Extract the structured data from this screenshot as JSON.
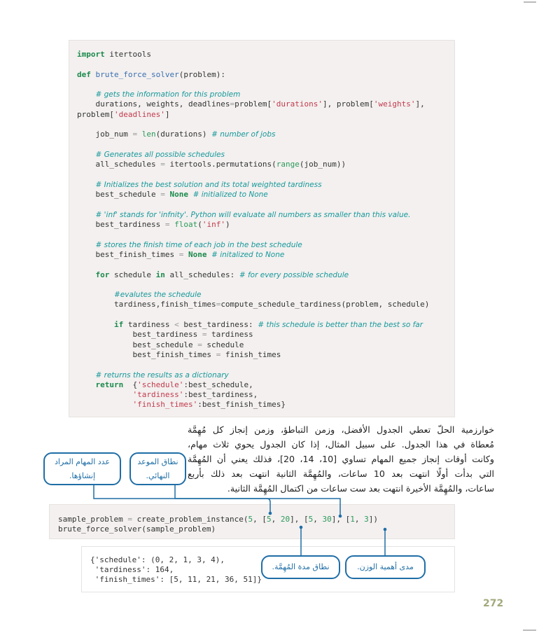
{
  "main_code": [
    [
      {
        "c": "k",
        "t": "import"
      },
      {
        "c": "",
        "t": " itertools"
      }
    ],
    [],
    [
      {
        "c": "k",
        "t": "def"
      },
      {
        "c": "",
        "t": " "
      },
      {
        "c": "f",
        "t": "brute_force_solver"
      },
      {
        "c": "",
        "t": "(problem):"
      }
    ],
    [],
    [
      {
        "c": "",
        "t": "    "
      },
      {
        "c": "c",
        "t": "# gets the information for this problem"
      }
    ],
    [
      {
        "c": "",
        "t": "    durations, weights, deadlines"
      },
      {
        "c": "o",
        "t": "="
      },
      {
        "c": "",
        "t": "problem["
      },
      {
        "c": "s",
        "t": "'durations'"
      },
      {
        "c": "",
        "t": "], problem["
      },
      {
        "c": "s",
        "t": "'weights'"
      },
      {
        "c": "",
        "t": "],"
      }
    ],
    [
      {
        "c": "",
        "t": "problem["
      },
      {
        "c": "s",
        "t": "'deadlines'"
      },
      {
        "c": "",
        "t": "]"
      }
    ],
    [],
    [
      {
        "c": "",
        "t": "    job_num "
      },
      {
        "c": "o",
        "t": "="
      },
      {
        "c": "",
        "t": " "
      },
      {
        "c": "b",
        "t": "len"
      },
      {
        "c": "",
        "t": "(durations) "
      },
      {
        "c": "c",
        "t": "# number of jobs"
      }
    ],
    [],
    [
      {
        "c": "",
        "t": "    "
      },
      {
        "c": "c",
        "t": "# Generates all possible schedules"
      }
    ],
    [
      {
        "c": "",
        "t": "    all_schedules "
      },
      {
        "c": "o",
        "t": "="
      },
      {
        "c": "",
        "t": " itertools.permutations("
      },
      {
        "c": "b",
        "t": "range"
      },
      {
        "c": "",
        "t": "(job_num))"
      }
    ],
    [],
    [
      {
        "c": "",
        "t": "    "
      },
      {
        "c": "c",
        "t": "# Initializes the best solution and its total weighted tardiness"
      }
    ],
    [
      {
        "c": "",
        "t": "    best_schedule "
      },
      {
        "c": "o",
        "t": "="
      },
      {
        "c": "",
        "t": " "
      },
      {
        "c": "k",
        "t": "None"
      },
      {
        "c": "",
        "t": " "
      },
      {
        "c": "c",
        "t": "# initialized to None"
      }
    ],
    [],
    [
      {
        "c": "",
        "t": "    "
      },
      {
        "c": "c",
        "t": "# 'inf' stands for 'infnity'. Python will evaluate all numbers as smaller than this value."
      }
    ],
    [
      {
        "c": "",
        "t": "    best_tardiness "
      },
      {
        "c": "o",
        "t": "="
      },
      {
        "c": "",
        "t": " "
      },
      {
        "c": "b",
        "t": "float"
      },
      {
        "c": "",
        "t": "("
      },
      {
        "c": "s",
        "t": "'inf'"
      },
      {
        "c": "",
        "t": ")"
      }
    ],
    [],
    [
      {
        "c": "",
        "t": "    "
      },
      {
        "c": "c",
        "t": "# stores the finish time of each job in the best schedule"
      }
    ],
    [
      {
        "c": "",
        "t": "    best_finish_times "
      },
      {
        "c": "o",
        "t": "="
      },
      {
        "c": "",
        "t": " "
      },
      {
        "c": "k",
        "t": "None"
      },
      {
        "c": "",
        "t": " "
      },
      {
        "c": "c",
        "t": "# initalized to None"
      }
    ],
    [],
    [
      {
        "c": "",
        "t": "    "
      },
      {
        "c": "k",
        "t": "for"
      },
      {
        "c": "",
        "t": " schedule "
      },
      {
        "c": "k",
        "t": "in"
      },
      {
        "c": "",
        "t": " all_schedules: "
      },
      {
        "c": "c",
        "t": "# for every possible schedule"
      }
    ],
    [],
    [
      {
        "c": "",
        "t": "        "
      },
      {
        "c": "c",
        "t": "#evalutes the schedule"
      }
    ],
    [
      {
        "c": "",
        "t": "        tardiness,finish_times"
      },
      {
        "c": "o",
        "t": "="
      },
      {
        "c": "",
        "t": "compute_schedule_tardiness(problem, schedule)"
      }
    ],
    [],
    [
      {
        "c": "",
        "t": "        "
      },
      {
        "c": "k",
        "t": "if"
      },
      {
        "c": "",
        "t": " tardiness "
      },
      {
        "c": "o",
        "t": "<"
      },
      {
        "c": "",
        "t": " best_tardiness: "
      },
      {
        "c": "c",
        "t": "# this schedule is better than the best so far"
      }
    ],
    [
      {
        "c": "",
        "t": "            best_tardiness "
      },
      {
        "c": "o",
        "t": "="
      },
      {
        "c": "",
        "t": " tardiness"
      }
    ],
    [
      {
        "c": "",
        "t": "            best_schedule "
      },
      {
        "c": "o",
        "t": "="
      },
      {
        "c": "",
        "t": " schedule"
      }
    ],
    [
      {
        "c": "",
        "t": "            best_finish_times "
      },
      {
        "c": "o",
        "t": "="
      },
      {
        "c": "",
        "t": " finish_times"
      }
    ],
    [],
    [
      {
        "c": "",
        "t": "    "
      },
      {
        "c": "c",
        "t": "# returns the results as a dictionary"
      }
    ],
    [
      {
        "c": "",
        "t": "    "
      },
      {
        "c": "k",
        "t": "return"
      },
      {
        "c": "",
        "t": "  {"
      },
      {
        "c": "s",
        "t": "'schedule'"
      },
      {
        "c": "",
        "t": ":best_schedule,"
      }
    ],
    [
      {
        "c": "",
        "t": "            "
      },
      {
        "c": "s",
        "t": "'tardiness'"
      },
      {
        "c": "",
        "t": ":best_tardiness,"
      }
    ],
    [
      {
        "c": "",
        "t": "            "
      },
      {
        "c": "s",
        "t": "'finish_times'"
      },
      {
        "c": "",
        "t": ":best_finish_times}"
      }
    ]
  ],
  "paragraph": [
    "خوارزمية الحلّ تعطي الجدول الأفضل، وزمن التباطؤ، وزمن إنجاز كل مُهِمَّة",
    "مُعطاة في هذا الجدول. على سبيل المثال، إذا كان الجدول يحوي ثلاث مهام،",
    "وكانت أوقات إنجاز جميع المهام تساوي [10، 14، 20]، فذلك يعني أن المُهِمَّة",
    "التي بدأت أولًا انتهت بعد 10 ساعات، والمُهِمَّة الثانية انتهت بعد ذلك بأربع",
    "ساعات، والمُهِمَّة الأخيرة انتهت بعد ست ساعات من اكتمال المُهِمَّة الثانية."
  ],
  "sample_code": [
    [
      {
        "c": "",
        "t": "sample_problem "
      },
      {
        "c": "o",
        "t": "="
      },
      {
        "c": "",
        "t": " create_problem_instance("
      },
      {
        "c": "n",
        "t": "5"
      },
      {
        "c": "",
        "t": ", ["
      },
      {
        "c": "n",
        "t": "5"
      },
      {
        "c": "",
        "t": ", "
      },
      {
        "c": "n",
        "t": "20"
      },
      {
        "c": "",
        "t": "], ["
      },
      {
        "c": "n",
        "t": "5"
      },
      {
        "c": "",
        "t": ", "
      },
      {
        "c": "n",
        "t": "30"
      },
      {
        "c": "",
        "t": "], ["
      },
      {
        "c": "n",
        "t": "1"
      },
      {
        "c": "",
        "t": ", "
      },
      {
        "c": "n",
        "t": "3"
      },
      {
        "c": "",
        "t": "])"
      }
    ],
    [
      {
        "c": "",
        "t": "brute_force_solver(sample_problem)"
      }
    ]
  ],
  "output": [
    "{'schedule': (0, 2, 1, 3, 4),",
    " 'tardiness': 164,",
    " 'finish_times': [5, 11, 21, 36, 51]}"
  ],
  "callouts": {
    "num_jobs": "عدد المهام المراد إنشاؤها.",
    "deadline_range": "نطاق الموعد النهائي.",
    "duration_range": "نطاق مدة المُهِمَّة.",
    "weight_range": "مدى أهمية الوزن."
  },
  "colors": {
    "callout": "#1f6ea6",
    "keyword": "#1c8a4c",
    "comment": "#16989a",
    "string": "#c23a4c",
    "page_number": "#a3a97c"
  },
  "page_number": "272"
}
